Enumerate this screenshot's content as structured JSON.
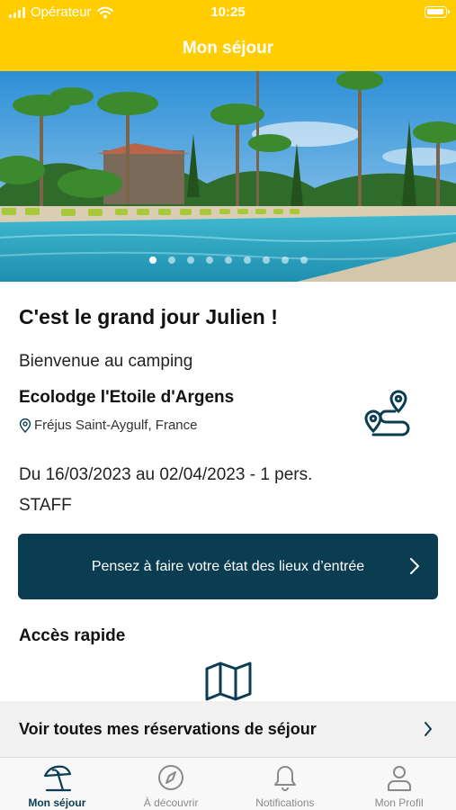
{
  "status_bar": {
    "carrier": "Opérateur",
    "time": "10:25"
  },
  "nav": {
    "title": "Mon séjour"
  },
  "carousel": {
    "slide_count": 9,
    "active_index": 0
  },
  "stay": {
    "greeting": "C'est le grand jour Julien !",
    "welcome": "Bienvenue au camping",
    "camping_name": "Ecolodge l'Etoile d'Argens",
    "location": "Fréjus Saint-Aygulf, France",
    "dates": "Du 16/03/2023 au 02/04/2023 - 1 pers.",
    "category": "STAFF"
  },
  "cta": {
    "label": "Pensez à faire votre état des lieux d’entrée"
  },
  "quick_access": {
    "title": "Accès rapide"
  },
  "reservations": {
    "label": "Voir toutes mes réservations de séjour"
  },
  "tabs": [
    {
      "label": "Mon séjour",
      "icon": "beach-umbrella-icon",
      "active": true
    },
    {
      "label": "À découvrir",
      "icon": "compass-icon",
      "active": false
    },
    {
      "label": "Notifications",
      "icon": "bell-icon",
      "active": false
    },
    {
      "label": "Mon Profil",
      "icon": "person-icon",
      "active": false
    }
  ],
  "colors": {
    "brand_yellow": "#ffcd00",
    "dark_teal": "#0b3d52",
    "inactive_gray": "#8a8a8a"
  }
}
